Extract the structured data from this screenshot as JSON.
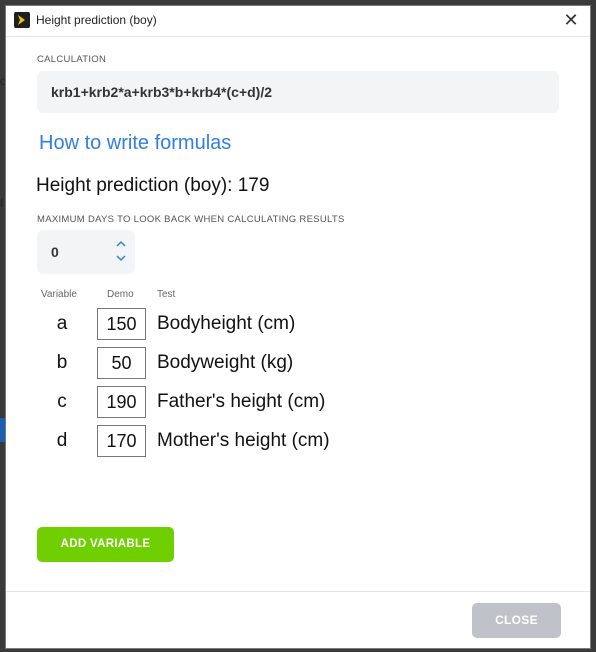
{
  "window": {
    "title": "Height prediction (boy)"
  },
  "calculation": {
    "label": "CALCULATION",
    "formula": "krb1+krb2*a+krb3*b+krb4*(c+d)/2"
  },
  "help_link": "How to write formulas",
  "prediction_text": "Height prediction (boy): 179",
  "days": {
    "label": "MAXIMUM DAYS TO LOOK BACK WHEN CALCULATING RESULTS",
    "value": "0"
  },
  "columns": {
    "variable": "Variable",
    "demo": "Demo",
    "test": "Test"
  },
  "variables": [
    {
      "letter": "a",
      "demo": "150",
      "description": "Bodyheight (cm)"
    },
    {
      "letter": "b",
      "demo": "50",
      "description": "Bodyweight (kg)"
    },
    {
      "letter": "c",
      "demo": "190",
      "description": "Father's height (cm)"
    },
    {
      "letter": "d",
      "demo": "170",
      "description": "Mother's height (cm)"
    }
  ],
  "buttons": {
    "add_variable": "ADD VARIABLE",
    "close": "CLOSE"
  },
  "colors": {
    "accent_green": "#6fcf00",
    "link_blue": "#2f7fe0",
    "disabled_gray": "#bfc3c9"
  }
}
